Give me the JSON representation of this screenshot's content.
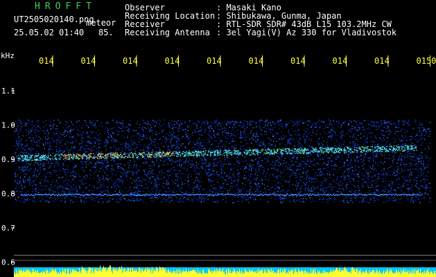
{
  "header": {
    "app_name": "HROFFT",
    "filename": "UT2505020140.png",
    "event_type": "meteor",
    "datetime": "25.05.02 01:40",
    "count": "85."
  },
  "info": [
    {
      "label": "Observer",
      "value": "Masaki Kano"
    },
    {
      "label": "Receiving Location",
      "value": "Shibukawa, Gunma, Japan"
    },
    {
      "label": "Receiver",
      "value": "RTL-SDR SDR# 43dB L15 103.2MHz CW"
    },
    {
      "label": "Receiving Antenna",
      "value": "3el Yagi(V) Az 330 for Vladivostok"
    }
  ],
  "y_axis": {
    "unit": "kHz",
    "ticks": [
      "1.1",
      "1.0",
      "0.9",
      "0.8",
      "0.7",
      "0.6"
    ]
  },
  "time_axis": {
    "ticks": [
      "014",
      "014",
      "014",
      "014",
      "014",
      "014",
      "014",
      "014",
      "014",
      "0150"
    ]
  },
  "colors": {
    "background": "#000000",
    "title_green": "#3bd35a",
    "time_yellow": "#ffff40",
    "noise_blue": "#1030c0",
    "cyan_floor": "#00c8ff"
  }
}
